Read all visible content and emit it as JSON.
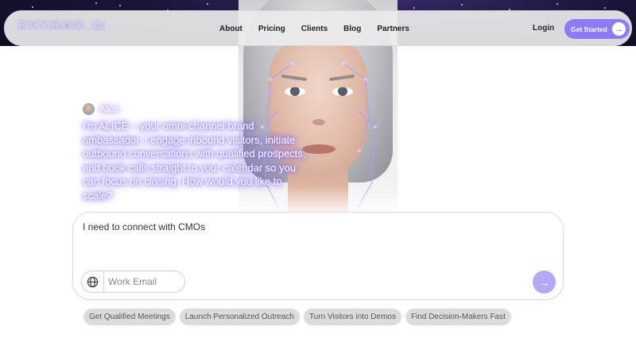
{
  "nav": {
    "logo": "EVYBOX.AI",
    "links": [
      "About",
      "Pricing",
      "Clients",
      "Blog",
      "Partners"
    ],
    "login": "Login",
    "cta_label": "Get Started",
    "cta_icon": "arrow-right-icon"
  },
  "alice": {
    "name": "Alice:",
    "message": "I'm ALICE – your omni-channel brand ambassador. I engage inbound visitors, initiate outbound conversations with qualified prospects, and book calls straight to your calendar so you can focus on closing. How would you like to scale?"
  },
  "chat": {
    "text": "I need to connect with CMOs",
    "email_placeholder": "Work Email",
    "send_icon": "arrow-right-icon"
  },
  "chips": [
    "Get Qualified Meetings",
    "Launch Personalized Outreach",
    "Turn Visitors into Demos",
    "Find Decision-Makers Fast"
  ],
  "colors": {
    "accent": "#8b7cf6",
    "send": "#b2a8f5",
    "glow": "#7d5ef0"
  }
}
